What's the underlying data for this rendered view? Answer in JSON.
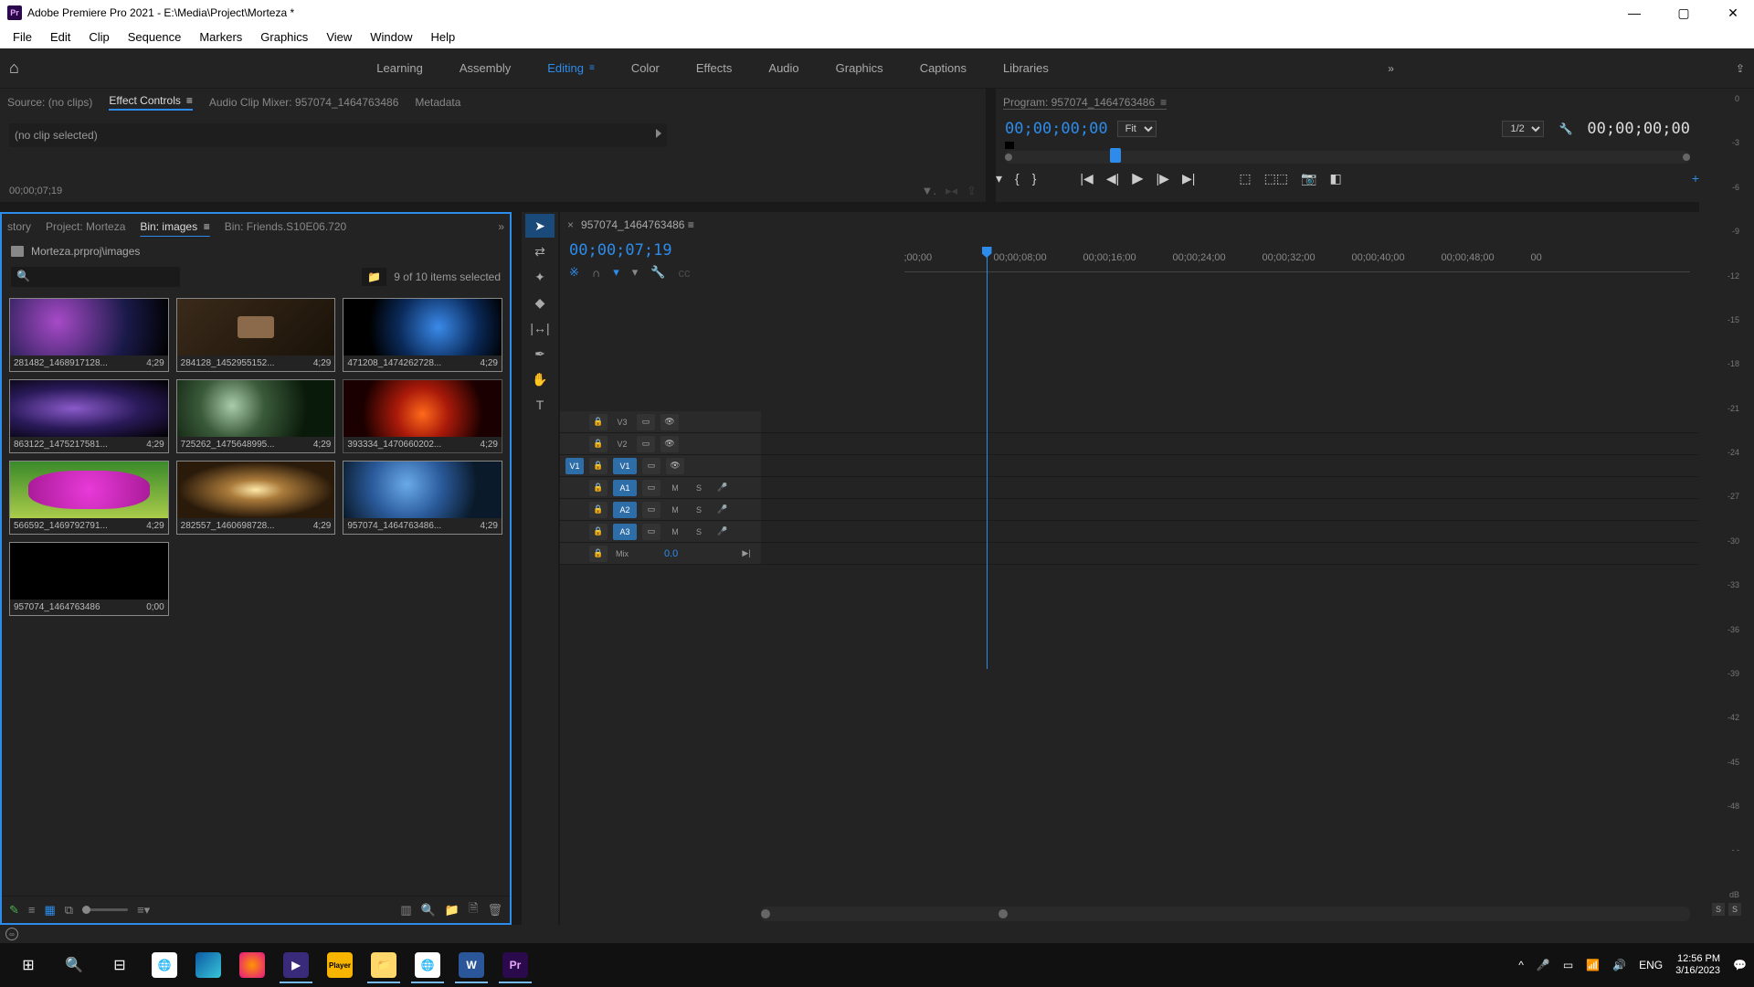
{
  "title": "Adobe Premiere Pro 2021 - E:\\Media\\Project\\Morteza *",
  "menu": [
    "File",
    "Edit",
    "Clip",
    "Sequence",
    "Markers",
    "Graphics",
    "View",
    "Window",
    "Help"
  ],
  "workspaces": [
    "Learning",
    "Assembly",
    "Editing",
    "Color",
    "Effects",
    "Audio",
    "Graphics",
    "Captions",
    "Libraries"
  ],
  "active_ws": "Editing",
  "source_tabs": {
    "source": "Source: (no clips)",
    "effect": "Effect Controls",
    "mixer": "Audio Clip Mixer: 957074_1464763486",
    "metadata": "Metadata"
  },
  "effect_body": "(no clip selected)",
  "effect_tc": "00;00;07;19",
  "program": {
    "title": "Program: 957074_1464763486",
    "tc": "00;00;00;00",
    "fit": "Fit",
    "res": "1/2",
    "duration": "00;00;00;00"
  },
  "project": {
    "tabs": {
      "story": "story",
      "project": "Project: Morteza",
      "bin": "Bin: images",
      "friends": "Bin: Friends.S10E06.720"
    },
    "path": "Morteza.prproj\\images",
    "items_text": "9 of 10 items selected",
    "clips": [
      {
        "name": "281482_1468917128...",
        "dur": "4;29",
        "sel": true,
        "th": "th1"
      },
      {
        "name": "284128_1452955152...",
        "dur": "4;29",
        "sel": true,
        "th": "th2"
      },
      {
        "name": "471208_1474262728...",
        "dur": "4;29",
        "sel": true,
        "th": "th3"
      },
      {
        "name": "863122_1475217581...",
        "dur": "4;29",
        "sel": true,
        "th": "th4"
      },
      {
        "name": "725262_1475648995...",
        "dur": "4;29",
        "sel": true,
        "th": "th5"
      },
      {
        "name": "393334_1470660202...",
        "dur": "4;29",
        "sel": false,
        "th": "th6"
      },
      {
        "name": "566592_1469792791...",
        "dur": "4;29",
        "sel": true,
        "th": "th7"
      },
      {
        "name": "282557_1460698728...",
        "dur": "4;29",
        "sel": true,
        "th": "th8"
      },
      {
        "name": "957074_1464763486...",
        "dur": "4;29",
        "sel": true,
        "th": "th9"
      },
      {
        "name": "957074_1464763486",
        "dur": "0;00",
        "sel": true,
        "th": "th10"
      }
    ]
  },
  "timeline": {
    "seq_name": "957074_1464763486",
    "tc": "00;00;07;19",
    "ticks": [
      ";00;00",
      "00;00;08;00",
      "00;00;16;00",
      "00;00;24;00",
      "00;00;32;00",
      "00;00;40;00",
      "00;00;48;00",
      "00"
    ],
    "vtracks": [
      "V3",
      "V2",
      "V1"
    ],
    "atracks": [
      "A1",
      "A2",
      "A3"
    ],
    "mix_label": "Mix",
    "mix_val": "0.0",
    "src_v": "V1",
    "mute": "M",
    "solo": "S"
  },
  "meter_db": [
    "0",
    "-3",
    "-6",
    "-9",
    "-12",
    "-15",
    "-18",
    "-21",
    "-24",
    "-27",
    "-30",
    "-33",
    "-36",
    "-39",
    "-42",
    "-45",
    "-48",
    "- -",
    "dB"
  ],
  "meter_solo": "S",
  "taskbar": {
    "lang": "ENG",
    "time": "12:56 PM",
    "date": "3/16/2023"
  }
}
